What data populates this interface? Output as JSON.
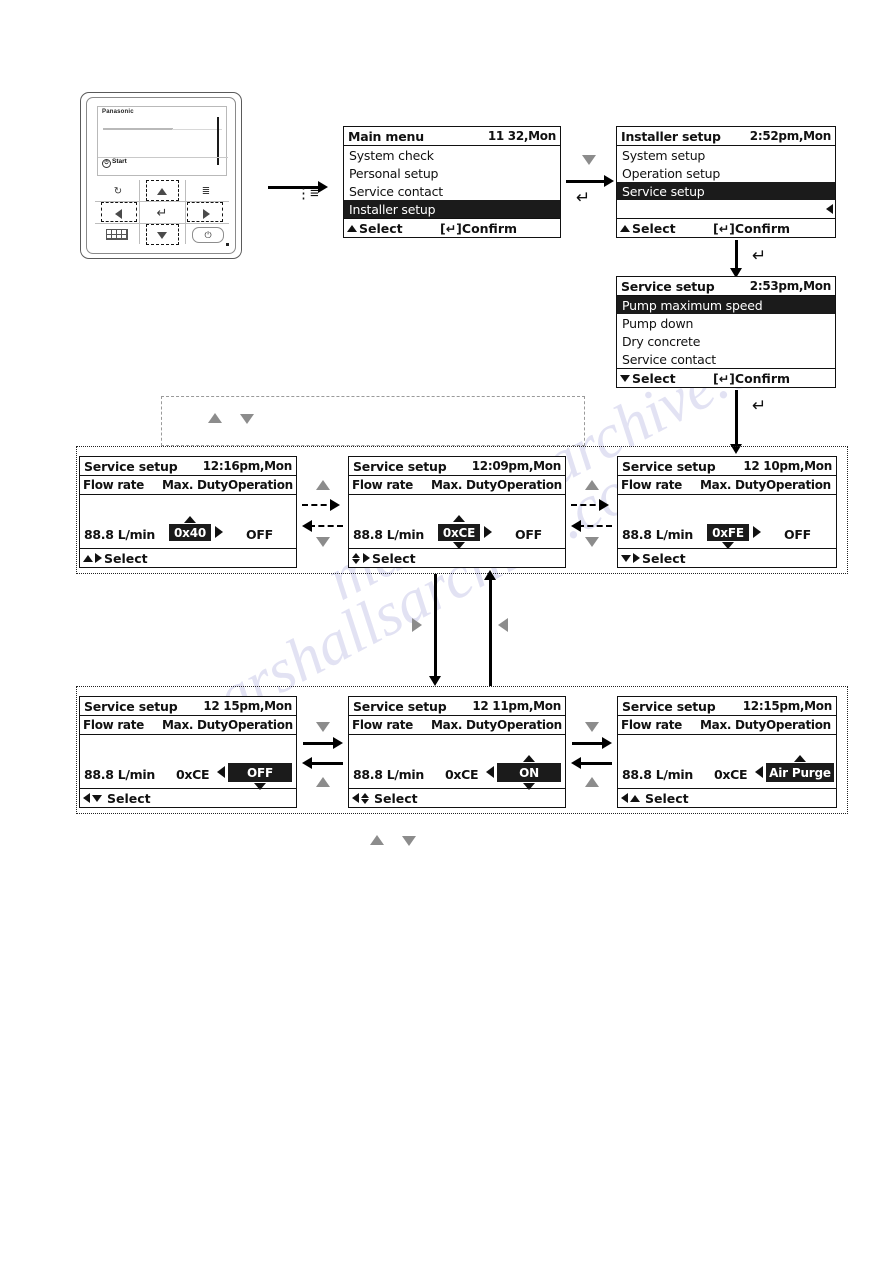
{
  "remote": {
    "brand": "Panasonic",
    "start_label": "Start",
    "keys": {
      "back": "back-arrow",
      "up": "up-arrow",
      "menu": "menu-list",
      "left": "left-arrow",
      "enter": "enter-arrow",
      "right": "right-arrow",
      "grid": "grid-keypad",
      "down": "down-arrow",
      "power": "power"
    }
  },
  "screens": {
    "main_menu": {
      "title": "Main menu",
      "time": "11 32,Mon",
      "items": [
        {
          "label": "System check",
          "selected": false
        },
        {
          "label": "Personal setup",
          "selected": false
        },
        {
          "label": "Service contact",
          "selected": false
        },
        {
          "label": "Installer setup",
          "selected": true
        }
      ],
      "footer_select": "Select",
      "footer_confirm": "[↵]Confirm"
    },
    "installer_setup": {
      "title": "Installer setup",
      "time": "2:52pm,Mon",
      "items": [
        {
          "label": "System setup",
          "selected": false
        },
        {
          "label": "Operation setup",
          "selected": false
        },
        {
          "label": "Service setup",
          "selected": true
        },
        {
          "label": "",
          "selected": false
        }
      ],
      "footer_select": "Select",
      "footer_confirm": "[↵]Confirm"
    },
    "service_setup_menu": {
      "title": "Service setup",
      "time": "2:53pm,Mon",
      "items": [
        {
          "label": "Pump maximum speed",
          "selected": true
        },
        {
          "label": "Pump down",
          "selected": false
        },
        {
          "label": "Dry concrete",
          "selected": false
        },
        {
          "label": "Service contact",
          "selected": false
        }
      ],
      "footer_select": "Select",
      "footer_confirm": "[↵]Confirm"
    },
    "columns": {
      "flow_rate": "Flow rate",
      "max_duty": "Max. Duty",
      "operation": "Operation"
    },
    "duty_min": {
      "title": "Service setup",
      "time": "12:16pm,Mon",
      "flow_rate": "88.8 L/min",
      "max_duty": "0x40",
      "operation": "OFF",
      "footer_select": "Select"
    },
    "duty_mid": {
      "title": "Service setup",
      "time": "12:09pm,Mon",
      "flow_rate": "88.8 L/min",
      "max_duty": "0xCE",
      "operation": "OFF",
      "footer_select": "Select"
    },
    "duty_max": {
      "title": "Service setup",
      "time": "12 10pm,Mon",
      "flow_rate": "88.8 L/min",
      "max_duty": "0xFE",
      "operation": "OFF",
      "footer_select": "Select"
    },
    "op_off": {
      "title": "Service setup",
      "time": "12 15pm,Mon",
      "flow_rate": "88.8 L/min",
      "max_duty": "0xCE",
      "operation": "OFF",
      "footer_select": "Select"
    },
    "op_on": {
      "title": "Service setup",
      "time": "12 11pm,Mon",
      "flow_rate": "88.8 L/min",
      "max_duty": "0xCE",
      "operation": "ON",
      "footer_select": "Select"
    },
    "op_air_purge": {
      "title": "Service setup",
      "time": "12:15pm,Mon",
      "flow_rate": "88.8 L/min",
      "max_duty": "0xCE",
      "operation": "Air Purge",
      "footer_select": "Select"
    }
  },
  "connectors": {
    "enter_glyph": "↵",
    "menu_glyph": "≡"
  },
  "watermark": {
    "line1": "marshallsarchive.com",
    "line2": "marshallsarchive.com"
  }
}
